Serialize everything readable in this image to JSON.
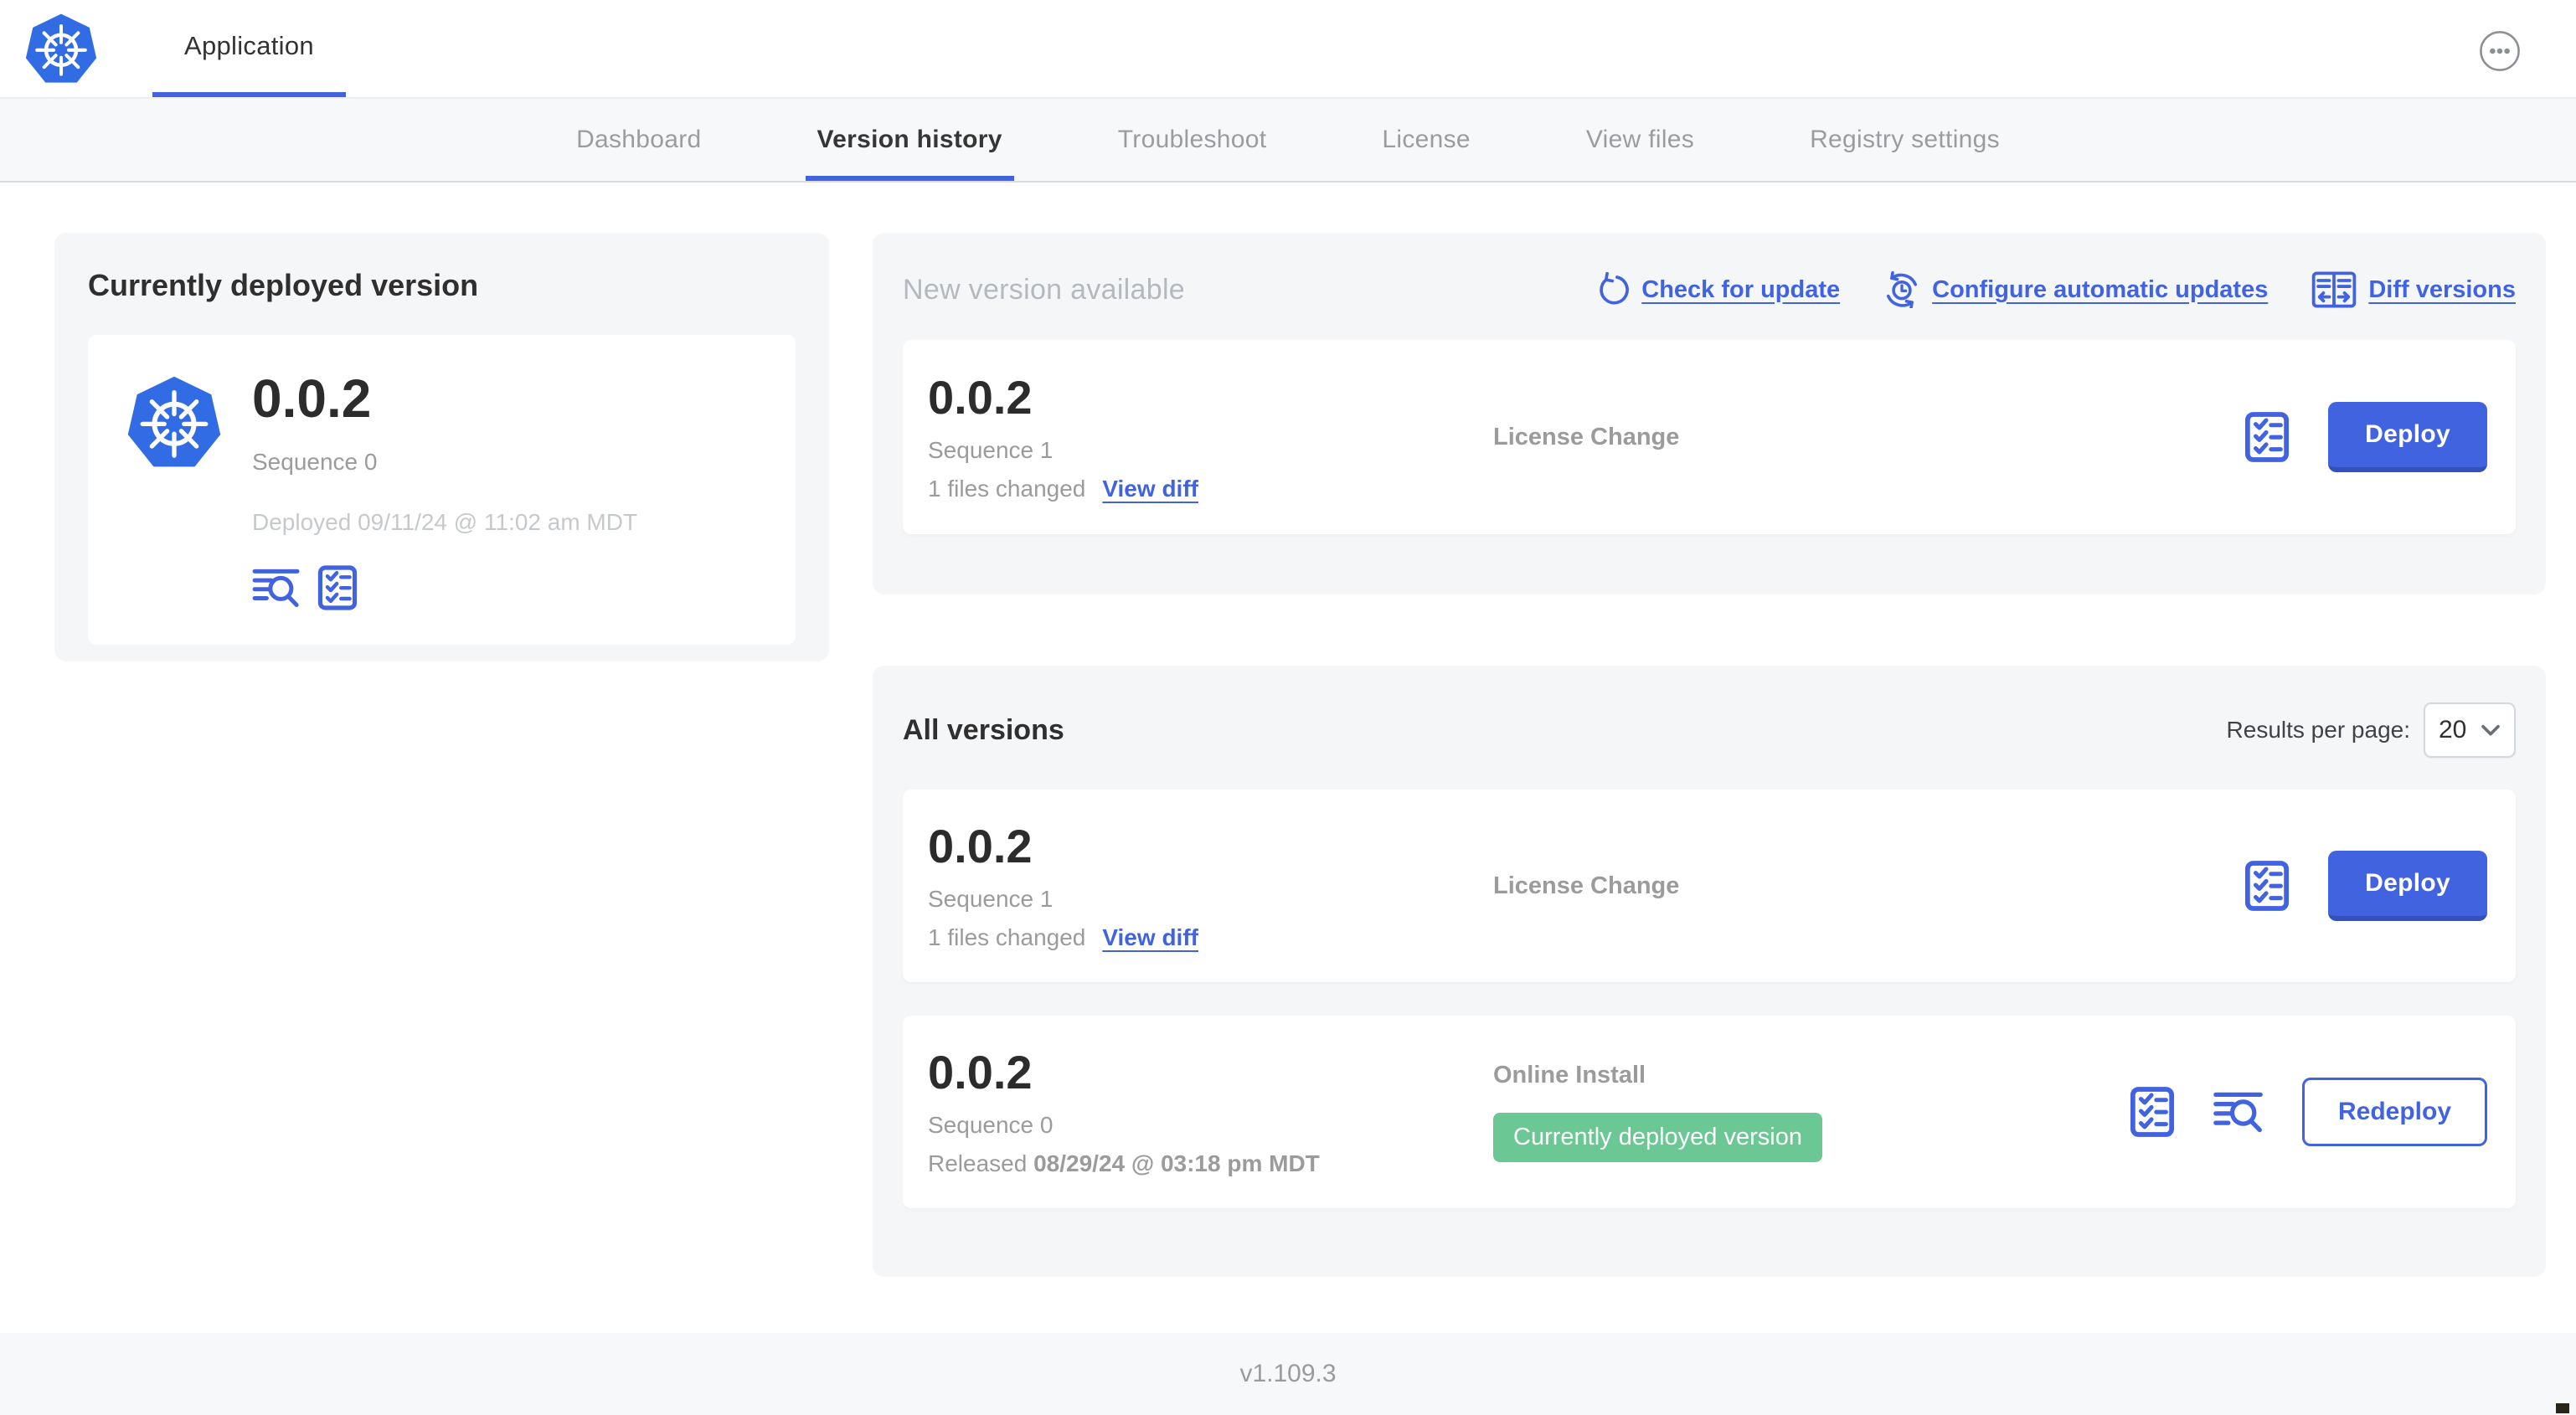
{
  "header": {
    "title": "Application"
  },
  "nav": {
    "tabs": [
      {
        "label": "Dashboard",
        "active": false
      },
      {
        "label": "Version history",
        "active": true
      },
      {
        "label": "Troubleshoot",
        "active": false
      },
      {
        "label": "License",
        "active": false
      },
      {
        "label": "View files",
        "active": false
      },
      {
        "label": "Registry settings",
        "active": false
      }
    ]
  },
  "currently_deployed": {
    "title": "Currently deployed version",
    "version": "0.0.2",
    "sequence": "Sequence 0",
    "deployed": "Deployed 09/11/24 @ 11:02 am MDT",
    "icons": [
      "logs-icon",
      "checklist-icon"
    ]
  },
  "new_version": {
    "title": "New version available",
    "links": {
      "check": "Check for update",
      "configure": "Configure automatic updates",
      "diff": "Diff versions"
    },
    "card": {
      "version": "0.0.2",
      "sequence": "Sequence 1",
      "files_changed": "1 files changed",
      "view_diff": "View diff",
      "source": "License Change",
      "action": "Deploy"
    }
  },
  "all_versions": {
    "title": "All versions",
    "results_label": "Results per page:",
    "results_value": "20",
    "cards": [
      {
        "version": "0.0.2",
        "sequence": "Sequence 1",
        "files_changed": "1 files changed",
        "view_diff": "View diff",
        "source": "License Change",
        "action": "Deploy"
      },
      {
        "version": "0.0.2",
        "sequence": "Sequence 0",
        "released_label": "Released",
        "released_date": "08/29/24 @ 03:18 pm MDT",
        "source": "Online Install",
        "badge": "Currently deployed version",
        "action": "Redeploy"
      }
    ]
  },
  "footer": {
    "app_version": "v1.109.3"
  },
  "colors": {
    "accent_blue": "#4263e0",
    "kubernetes_blue": "#326ce5",
    "badge_green": "#6bc794",
    "panel_gray": "#f5f6f8"
  }
}
